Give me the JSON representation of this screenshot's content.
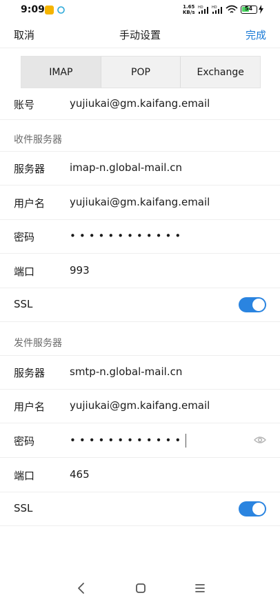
{
  "status_bar": {
    "time": "9:09",
    "net_speed_value": "1.65",
    "net_speed_unit": "KB/s",
    "battery": "54",
    "battery_level": 0.54
  },
  "nav": {
    "cancel": "取消",
    "title": "手动设置",
    "done": "完成"
  },
  "tabs": [
    {
      "label": "IMAP"
    },
    {
      "label": "POP"
    },
    {
      "label": "Exchange"
    }
  ],
  "account": {
    "label": "账号",
    "value": "yujiukai@gm.kaifang.email"
  },
  "incoming": {
    "header": "收件服务器",
    "server_label": "服务器",
    "server_value": "imap-n.global-mail.cn",
    "user_label": "用户名",
    "user_value": "yujiukai@gm.kaifang.email",
    "password_label": "密码",
    "password_value": "••••••••••••",
    "port_label": "端口",
    "port_value": "993",
    "ssl_label": "SSL",
    "ssl_on": true
  },
  "outgoing": {
    "header": "发件服务器",
    "server_label": "服务器",
    "server_value": "smtp-n.global-mail.cn",
    "user_label": "用户名",
    "user_value": "yujiukai@gm.kaifang.email",
    "password_label": "密码",
    "password_value": "••••••••••••",
    "port_label": "端口",
    "port_value": "465",
    "ssl_label": "SSL",
    "ssl_on": true
  },
  "colors": {
    "accent": "#1a7ad6",
    "toggle_on": "#2a84e0",
    "section_text": "#6b6b6b"
  },
  "icons": {
    "password_visibility": "eye-icon",
    "nav_back": "back-icon",
    "nav_home": "home-icon",
    "nav_menu": "menu-icon"
  }
}
